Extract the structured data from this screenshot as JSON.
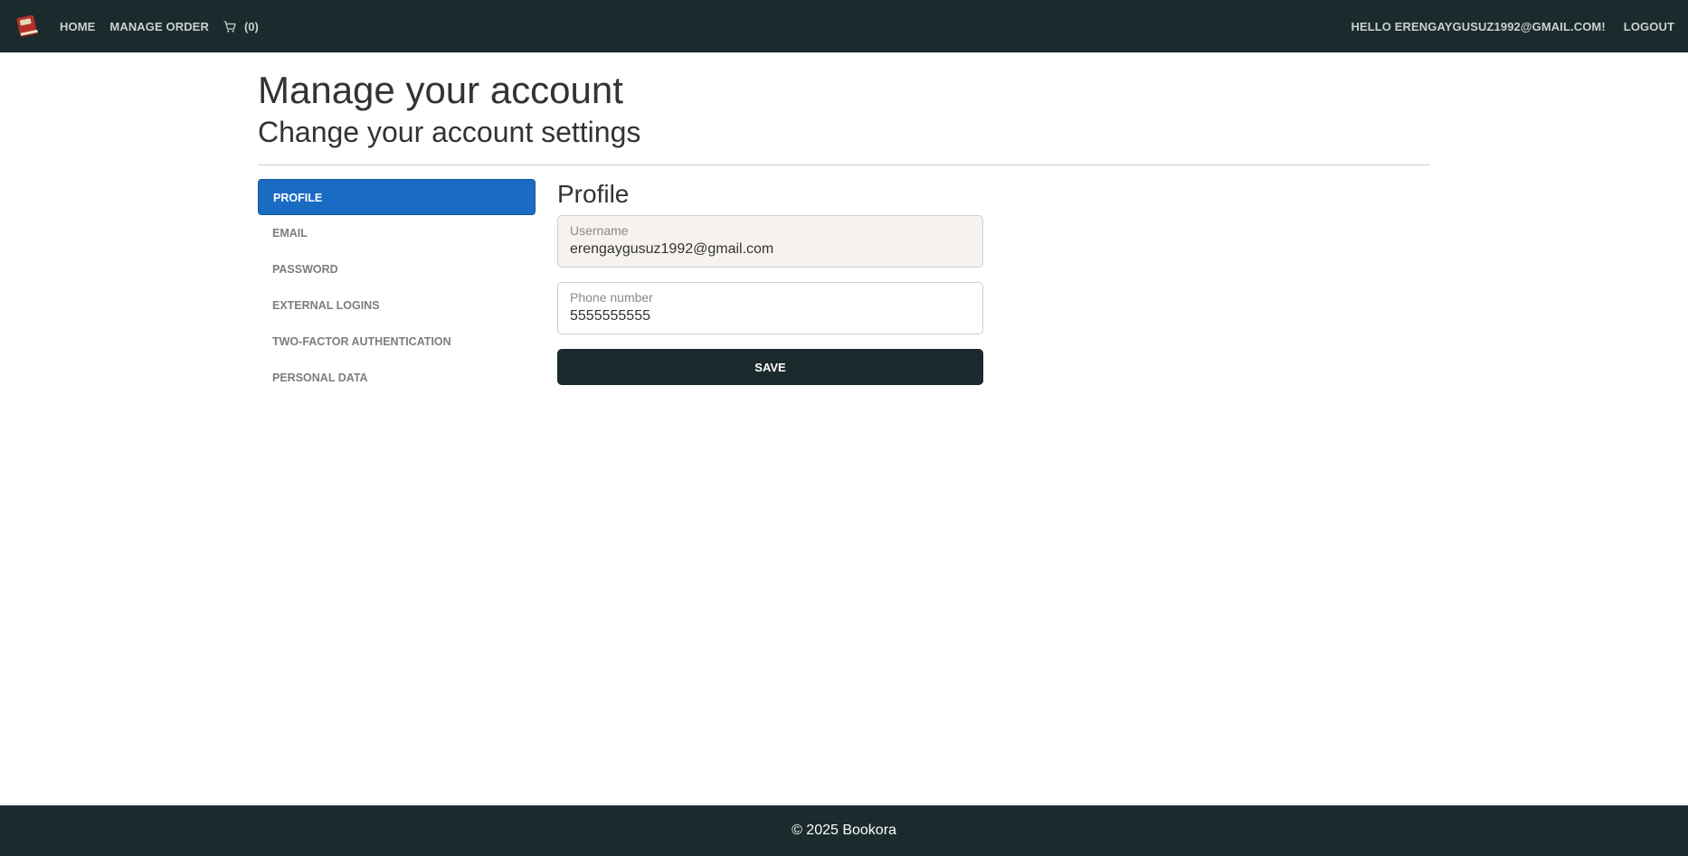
{
  "nav": {
    "logo_icon": "book-icon",
    "home_label": "HOME",
    "manage_order_label": "MANAGE ORDER",
    "cart_icon": "cart-icon",
    "cart_count": "(0)",
    "greeting": "HELLO ERENGAYGUSUZ1992@GMAIL.COM!",
    "logout_label": "LOGOUT"
  },
  "page": {
    "title": "Manage your account",
    "subtitle": "Change your account settings"
  },
  "sidebar": {
    "items": [
      {
        "label": "PROFILE",
        "active": true
      },
      {
        "label": "EMAIL",
        "active": false
      },
      {
        "label": "PASSWORD",
        "active": false
      },
      {
        "label": "EXTERNAL LOGINS",
        "active": false
      },
      {
        "label": "TWO-FACTOR AUTHENTICATION",
        "active": false
      },
      {
        "label": "PERSONAL DATA",
        "active": false
      }
    ]
  },
  "profile": {
    "heading": "Profile",
    "username_label": "Username",
    "username_value": "erengaygusuz1992@gmail.com",
    "phone_label": "Phone number",
    "phone_value": "5555555555",
    "save_label": "SAVE"
  },
  "footer": {
    "text": "© 2025 Bookora"
  },
  "colors": {
    "navbar_bg": "#1b2a2d",
    "active_item_bg": "#1a6bc4",
    "save_button_bg": "#1b2a2d",
    "readonly_field_bg": "#f6f3ef"
  }
}
